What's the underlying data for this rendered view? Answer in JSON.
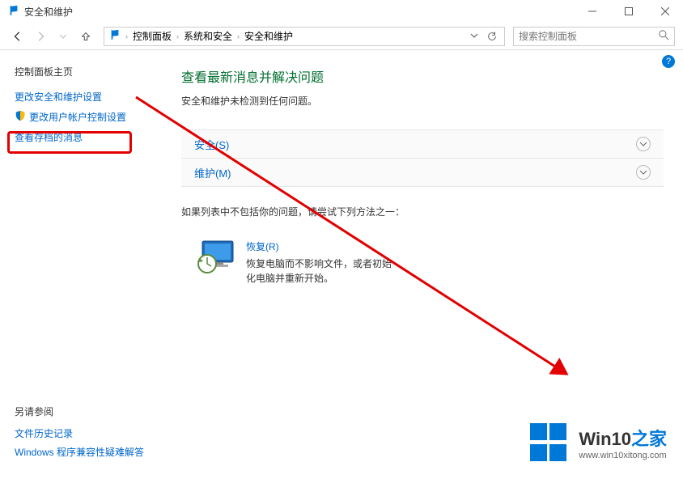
{
  "titlebar": {
    "title": "安全和维护"
  },
  "breadcrumb": {
    "items": [
      "控制面板",
      "系统和安全",
      "安全和维护"
    ],
    "sep": "›"
  },
  "search": {
    "placeholder": "搜索控制面板"
  },
  "sidebar": {
    "home": "控制面板主页",
    "link1": "更改安全和维护设置",
    "link2": "更改用户帐户控制设置",
    "link3": "查看存档的消息"
  },
  "main": {
    "heading": "查看最新消息并解决问题",
    "subtitle": "安全和维护未检测到任何问题。",
    "section1": "安全(S)",
    "section2": "维护(M)",
    "hint": "如果列表中不包括你的问题，请尝试下列方法之一：",
    "recovery_title": "恢复(R)",
    "recovery_desc": "恢复电脑而不影响文件，或者初始化电脑并重新开始。"
  },
  "footer": {
    "title": "另请参阅",
    "link1": "文件历史记录",
    "link2": "Windows 程序兼容性疑难解答"
  },
  "watermark": {
    "brand_a": "Win10",
    "brand_b": "之家",
    "url": "www.win10xitong.com"
  }
}
